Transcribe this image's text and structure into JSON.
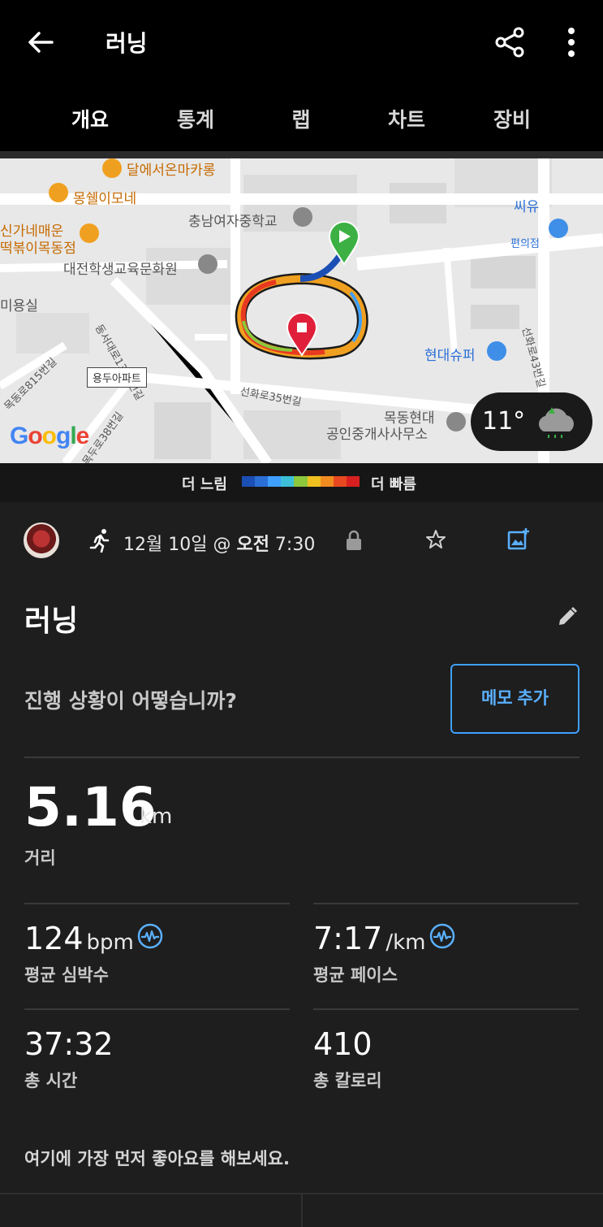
{
  "app": {
    "title": "러닝",
    "tabs": [
      "개요",
      "통계",
      "랩",
      "차트",
      "장비"
    ],
    "active_tab": "개요"
  },
  "map": {
    "labels": {
      "dessert": "달에서온마카롱",
      "cafe": "몽쉘이모네",
      "restaurant_line1": "신가네매운",
      "restaurant_line2": "떡볶이목동점",
      "school": "충남여자중학교",
      "center": "대전학생교육문화원",
      "salon": "미용실",
      "road1": "동서대로1352번길",
      "road2": "목동로815번길",
      "apt": "용두아파트",
      "road3": "선화로35번길",
      "road4": "목두로38번길",
      "store": "씨유",
      "store_sub": "편의점",
      "supermarket": "현대슈퍼",
      "road5": "선화로43번길",
      "realty_line1": "목동현대",
      "realty_line2": "공인중개사사무소"
    },
    "google_logo": "Google",
    "weather_temp": "11°"
  },
  "legend": {
    "slow": "더 느림",
    "fast": "더 빠름",
    "colors": [
      "#1c4fb5",
      "#2b6fd6",
      "#3fa0ff",
      "#3cc0d8",
      "#8cc83c",
      "#f0c020",
      "#f08c20",
      "#e84820",
      "#d82020"
    ]
  },
  "activity": {
    "date_pre": "12월 10일 @ ",
    "ampm": "오전",
    "time": " 7:30",
    "name": "러닝",
    "prompt": "진행 상황이 어떻습니까?",
    "memo_button": "메모 추가"
  },
  "stats": {
    "distance": {
      "value": "5.16",
      "unit": "km",
      "label": "거리"
    },
    "avg_hr": {
      "value": "124",
      "unit": "bpm",
      "label": "평균 심박수"
    },
    "avg_pace": {
      "value": "7:17",
      "unit": "/km",
      "label": "평균 페이스"
    },
    "total_time": {
      "value": "37:32",
      "label": "총 시간"
    },
    "calories": {
      "value": "410",
      "label": "총 칼로리"
    }
  },
  "social": {
    "like_prompt": "여기에 가장 먼저 좋아요를 해보세요."
  }
}
